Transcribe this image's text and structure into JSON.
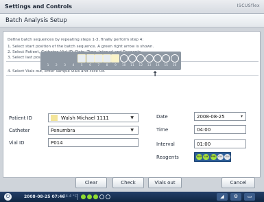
{
  "window": {
    "title": "Settings and Controls",
    "brand": "ISCUSflex"
  },
  "section_heading": "Batch Analysis Setup",
  "instructions": {
    "intro": "Define batch sequences by repeating steps 1-3, finally perform step 4:",
    "step1": "1. Select start position of the batch sequence. A green right arrow is shown.",
    "step2": "2. Select Patient, Catheter, Vial ID, Date, Time, Interval and Reagents",
    "step3": "3. Select last position in sequence",
    "step4": "4. Select Vials out, enter sample vials and click OK"
  },
  "sequence": {
    "positions": [
      {
        "n": "1",
        "style": "none"
      },
      {
        "n": "2",
        "style": "none"
      },
      {
        "n": "3",
        "style": "none"
      },
      {
        "n": "4",
        "style": "none"
      },
      {
        "n": "5",
        "style": "square"
      },
      {
        "n": "6",
        "style": "square"
      },
      {
        "n": "7",
        "style": "square"
      },
      {
        "n": "8",
        "style": "square"
      },
      {
        "n": "9",
        "style": "square-selected"
      },
      {
        "n": "10",
        "style": "circle"
      },
      {
        "n": "11",
        "style": "circle"
      },
      {
        "n": "12",
        "style": "circle"
      },
      {
        "n": "13",
        "style": "circle"
      },
      {
        "n": "14",
        "style": "circle"
      },
      {
        "n": "15",
        "style": "circle"
      },
      {
        "n": "16",
        "style": "circle"
      }
    ],
    "arrow": "↑"
  },
  "form": {
    "patient_label": "Patient ID",
    "patient_value": "Walsh Michael 1111",
    "catheter_label": "Catheter",
    "catheter_value": "Penumbra",
    "vial_label": "Vial ID",
    "vial_value": "P014",
    "date_label": "Date",
    "date_value": "2008-08-25",
    "time_label": "Time",
    "time_value": "04:00",
    "interval_label": "Interval",
    "interval_value": "01:00",
    "reagents_label": "Reagents"
  },
  "reagents": [
    {
      "code": "GLU",
      "active": true
    },
    {
      "code": "LAC",
      "active": true
    },
    {
      "code": "PYR",
      "active": true
    },
    {
      "code": "GLY",
      "active": false
    },
    {
      "code": "GLY",
      "active": false
    }
  ],
  "buttons": {
    "clear": "Clear",
    "check": "Check",
    "vials_out": "Vials out",
    "cancel": "Cancel"
  },
  "taskbar": {
    "datetime": "2008-08-25 07:46",
    "temp": "24.4 °C"
  },
  "colors": {
    "accent": "#2d5e98",
    "active_reagent": "#a8e43a",
    "selected_position": "#fbf4c9"
  }
}
